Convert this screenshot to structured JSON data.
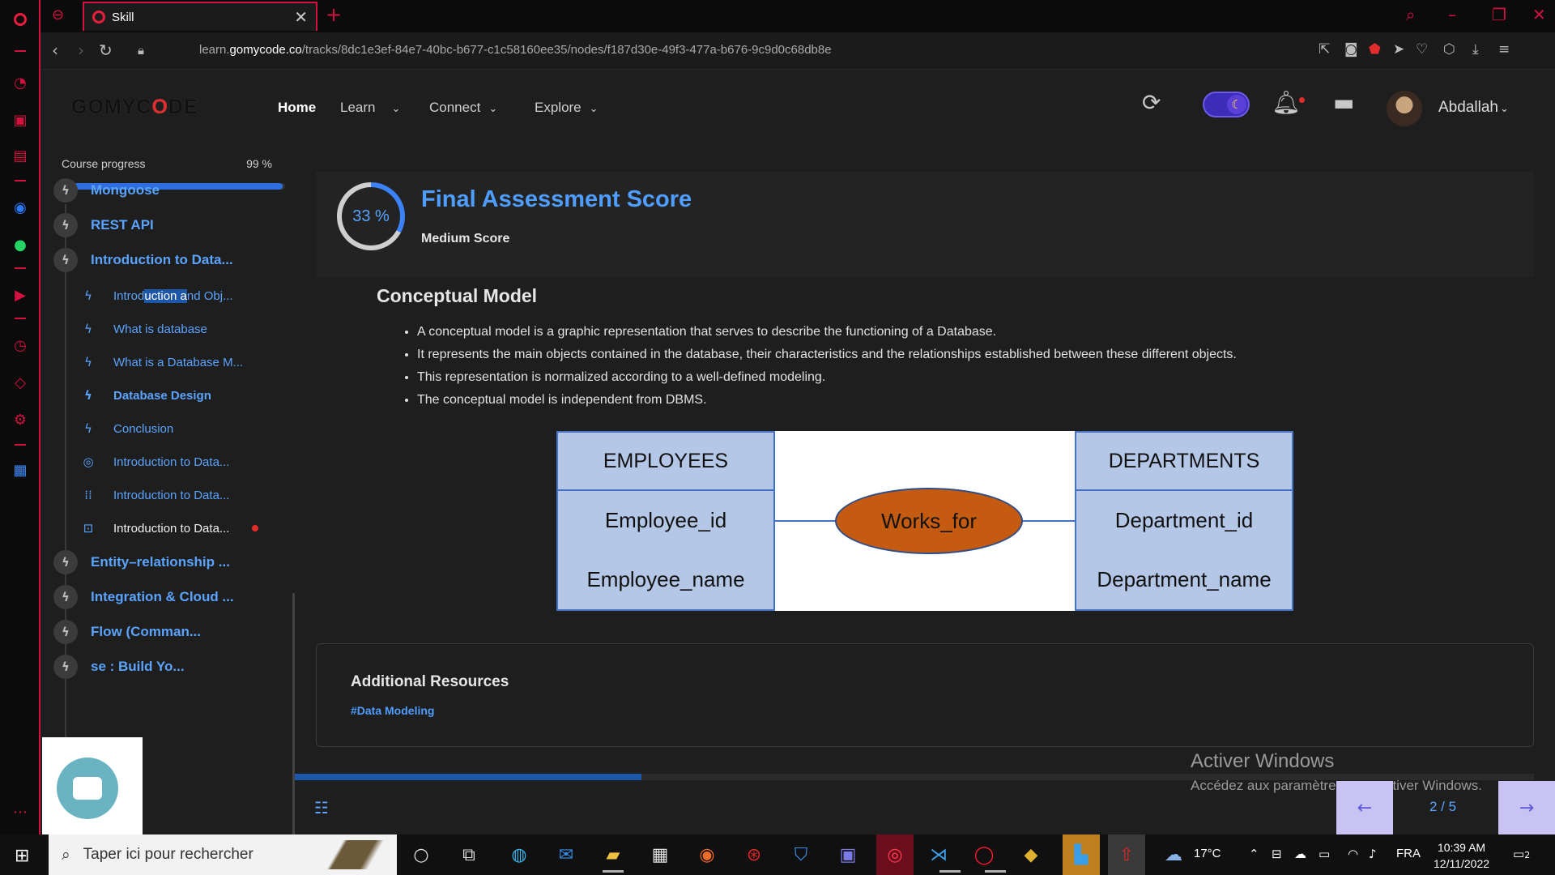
{
  "browser": {
    "tab_title": "Skill",
    "url_prefix": "learn.",
    "url_domain": "gomycode.co",
    "url_path": "/tracks/8dc1e3ef-84e7-40bc-b677-c1c58160ee35/nodes/f187d30e-49f3-477a-b676-9c9d0c68db8e"
  },
  "header": {
    "logo_text_a": "GOMYC",
    "logo_text_b": "O",
    "logo_text_c": "DE",
    "nav": {
      "home": "Home",
      "learn": "Learn",
      "connect": "Connect",
      "explore": "Explore"
    },
    "username": "Abdallah"
  },
  "sidebar": {
    "progress_label": "Course progress",
    "progress_value": "99 %",
    "progress_fraction": 0.99,
    "modules": [
      "Mongoose",
      "REST API",
      "Introduction to Data...",
      "Entity–relationship ...",
      "Integration & Cloud ...",
      "Flow (Comman...",
      "se : Build Yo..."
    ],
    "lessons": [
      {
        "a": "Introd",
        "b": "uction a",
        "c": "nd Obj..."
      },
      {
        "label": "What is database"
      },
      {
        "label": "What is a Database M..."
      },
      {
        "label": "Database Design"
      },
      {
        "label": "Conclusion"
      },
      {
        "label": "Introduction to Data..."
      },
      {
        "label": "Introduction to Data..."
      },
      {
        "label": "Introduction to Data..."
      }
    ]
  },
  "score": {
    "percent_text": "33 %",
    "percent_value": 33,
    "title": "Final Assessment Score",
    "level": "Medium Score"
  },
  "content": {
    "title": "Conceptual Model",
    "bullets": [
      "A conceptual model is a graphic representation that serves to describe the functioning of a Database.",
      "It represents the main objects contained in the database, their characteristics and the relationships established between these different objects.",
      "This representation is normalized according to a well-defined modeling.",
      "The conceptual model is independent from DBMS."
    ],
    "diagram": {
      "left_entity": {
        "name": "EMPLOYEES",
        "attrs": [
          "Employee_id",
          "Employee_name"
        ]
      },
      "relation": "Works_for",
      "right_entity": {
        "name": "DEPARTMENTS",
        "attrs": [
          "Department_id",
          "Department_name"
        ]
      },
      "colors": {
        "entity_fill": "#b4c7e7",
        "entity_border": "#4472c4",
        "relation_fill": "#c55a11"
      }
    }
  },
  "resources": {
    "title": "Additional Resources",
    "tag": "#Data Modeling"
  },
  "lesson_progress_fraction": 0.28,
  "pager": {
    "text": "2 / 5"
  },
  "watermark": {
    "line1": "Activer Windows",
    "line2": "Accédez aux paramètres pour activer Windows."
  },
  "taskbar": {
    "search_placeholder": "Taper ici pour rechercher",
    "weather": "17°C",
    "lang": "FRA",
    "time": "10:39 AM",
    "date": "12/11/2022",
    "notifications": "2"
  },
  "colors": {
    "accent_blue": "#4f9dff",
    "opera_red": "#d3113f",
    "background": "#1e1e1e"
  }
}
